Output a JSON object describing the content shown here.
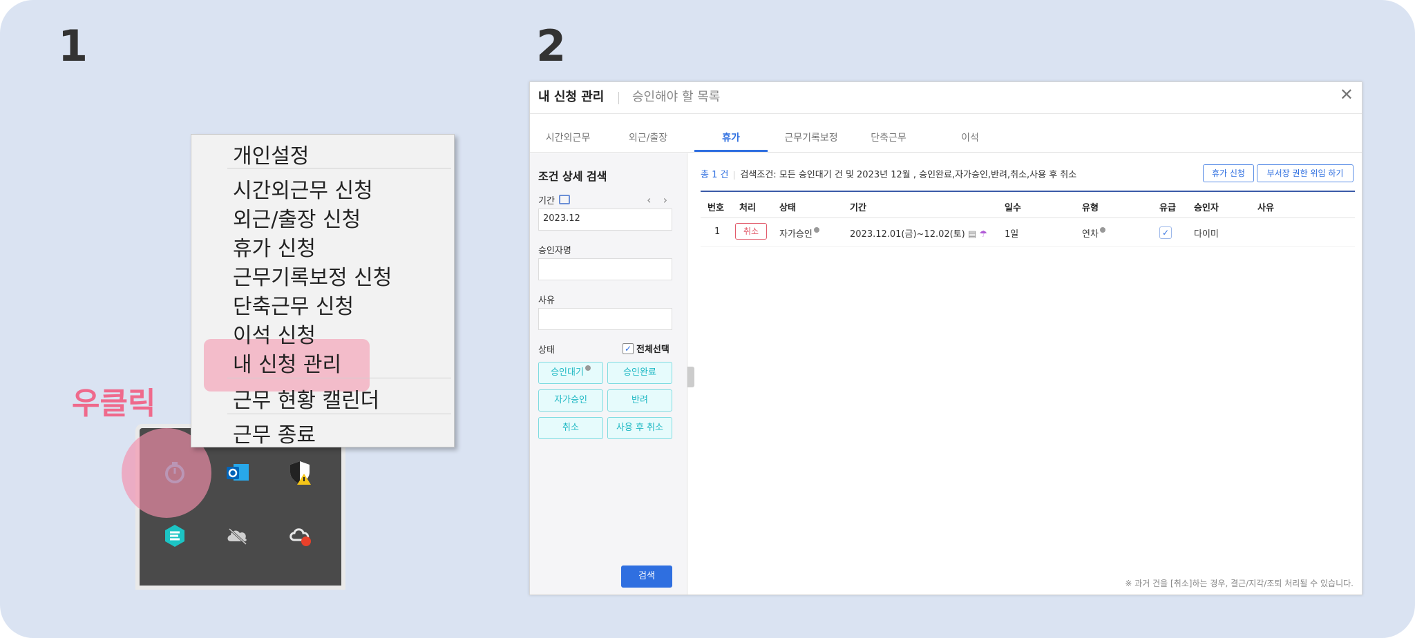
{
  "steps": {
    "one": "1",
    "two": "2"
  },
  "right_click_label": "우클릭",
  "context_menu": {
    "items": [
      "개인설정",
      "시간외근무 신청",
      "외근/출장 신청",
      "휴가 신청",
      "근무기록보정 신청",
      "단축근무 신청",
      "이석 신청",
      "내 신청 관리",
      "근무 현황 캘린더",
      "근무 종료"
    ]
  },
  "tray_icons": [
    "timer-app-icon",
    "outlook-icon",
    "security-shield-icon",
    "edge-app-icon",
    "cloud-offline-icon",
    "creative-cloud-icon"
  ],
  "window": {
    "title": "내 신청 관리",
    "subtitle": "승인해야 할 목록",
    "tabs": [
      "시간외근무",
      "외근/출장",
      "휴가",
      "근무기록보정",
      "단축근무",
      "이석"
    ],
    "active_tab": "휴가"
  },
  "sidebar": {
    "heading": "조건 상세 검색",
    "period_label": "기간",
    "period_value": "2023.12",
    "approver_label": "승인자명",
    "approver_value": "",
    "reason_label": "사유",
    "reason_value": "",
    "state_label": "상태",
    "select_all_label": "전체선택",
    "state_buttons": [
      "승인대기",
      "승인완료",
      "자가승인",
      "반려",
      "취소",
      "사용 후 취소"
    ],
    "search_button": "검색"
  },
  "main": {
    "total": "총 1 건",
    "criteria": "검색조건: 모든 승인대기 건 및 2023년 12월 , 승인완료,자가승인,반려,취소,사용 후 취소",
    "btn_leave_request": "휴가 신청",
    "btn_delegate": "부서장 권한 위임 하기",
    "columns": [
      "번호",
      "처리",
      "상태",
      "기간",
      "일수",
      "유형",
      "유급",
      "승인자",
      "사유"
    ],
    "rows": [
      {
        "no": "1",
        "action": "취소",
        "status": "자가승인",
        "period": "2023.12.01(금)~12.02(토)",
        "days": "1일",
        "type": "연차",
        "paid": true,
        "approver": "다이미",
        "reason": ""
      }
    ],
    "footnote": "※ 과거 건을 [취소]하는 경우, 결근/지각/조퇴 처리될 수 있습니다."
  }
}
